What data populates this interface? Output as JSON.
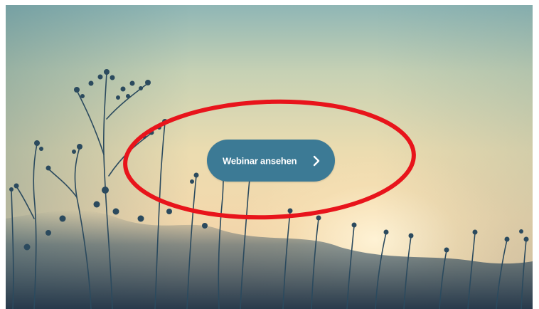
{
  "hero": {
    "background_image": "wildflowers-sunset",
    "cta": {
      "label": "Webinar ansehen",
      "icon": "chevron-right-icon",
      "color": "#3c7a95"
    }
  },
  "annotation": {
    "shape": "ellipse",
    "color": "#e8141b"
  }
}
